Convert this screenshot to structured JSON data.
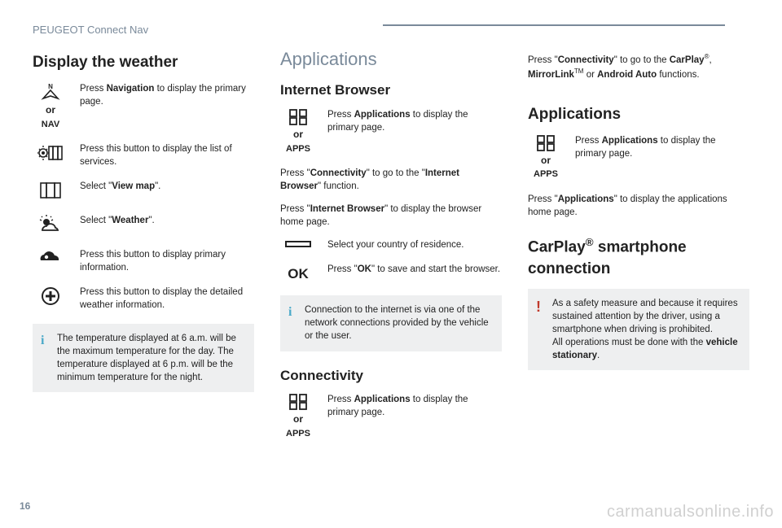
{
  "header": "PEUGEOT Connect Nav",
  "page_number": "16",
  "watermark": "carmanualsonline.info",
  "col1": {
    "title": "Display the weather",
    "nav_item": {
      "or": "or",
      "label": "NAV",
      "text_pre": "Press ",
      "text_bold": "Navigation",
      "text_post": " to display the primary page."
    },
    "services_item": "Press this button to display the list of services.",
    "viewmap_pre": "Select \"",
    "viewmap_bold": "View map",
    "viewmap_post": "\".",
    "weather_pre": "Select \"",
    "weather_bold": "Weather",
    "weather_post": "\".",
    "primary_info": "Press this button to display primary information.",
    "detailed_info": "Press this button to display the detailed weather information.",
    "note": "The temperature displayed at 6 a.m. will be the maximum temperature for the day. The temperature displayed at 6 p.m. will be the minimum temperature for the night."
  },
  "col2": {
    "section": "Applications",
    "browser_title": "Internet Browser",
    "apps_item": {
      "or": "or",
      "label": "APPS",
      "text_pre": "Press ",
      "text_bold": "Applications",
      "text_post": " to display the primary page."
    },
    "connectivity1_pre": "Press \"",
    "connectivity1_bold": "Connectivity",
    "connectivity1_mid": "\" to go to the \"",
    "connectivity1_bold2": "Internet Browser",
    "connectivity1_post": "\" function.",
    "browser2_pre": "Press \"",
    "browser2_bold": "Internet Browser",
    "browser2_post": "\" to display the browser home page.",
    "country": "Select your country of residence.",
    "ok_label": "OK",
    "ok_pre": "Press \"",
    "ok_bold": "OK",
    "ok_post": "\" to save and start the browser.",
    "note": "Connection to the internet is via one of the network connections provided by the vehicle or the user.",
    "connectivity_title": "Connectivity",
    "apps_item2": {
      "or": "or",
      "label": "APPS",
      "text_pre": "Press ",
      "text_bold": "Applications",
      "text_post": " to display the primary page."
    }
  },
  "col3": {
    "top_pre": "Press \"",
    "top_bold1": "Connectivity",
    "top_mid1": "\" to go to the ",
    "top_bold2": "CarPlay",
    "top_sup2": "®",
    "top_mid2": ", ",
    "top_bold3": "MirrorLink",
    "top_sup3": "TM",
    "top_mid3": " or ",
    "top_bold4": "Android Auto",
    "top_post": " functions.",
    "apps_title": "Applications",
    "apps_item": {
      "or": "or",
      "label": "APPS",
      "text_pre": "Press ",
      "text_bold": "Applications",
      "text_post": " to display the primary page."
    },
    "apps2_pre": "Press \"",
    "apps2_bold": "Applications",
    "apps2_post": "\" to display the applications home page.",
    "carplay_title_pre": "CarPlay",
    "carplay_title_sup": "®",
    "carplay_title_post": " smartphone connection",
    "warn1": "As a safety measure and because it requires sustained attention by the driver, using a smartphone when driving is prohibited.",
    "warn2_pre": "All operations must be done with the ",
    "warn2_bold": "vehicle stationary",
    "warn2_post": "."
  }
}
